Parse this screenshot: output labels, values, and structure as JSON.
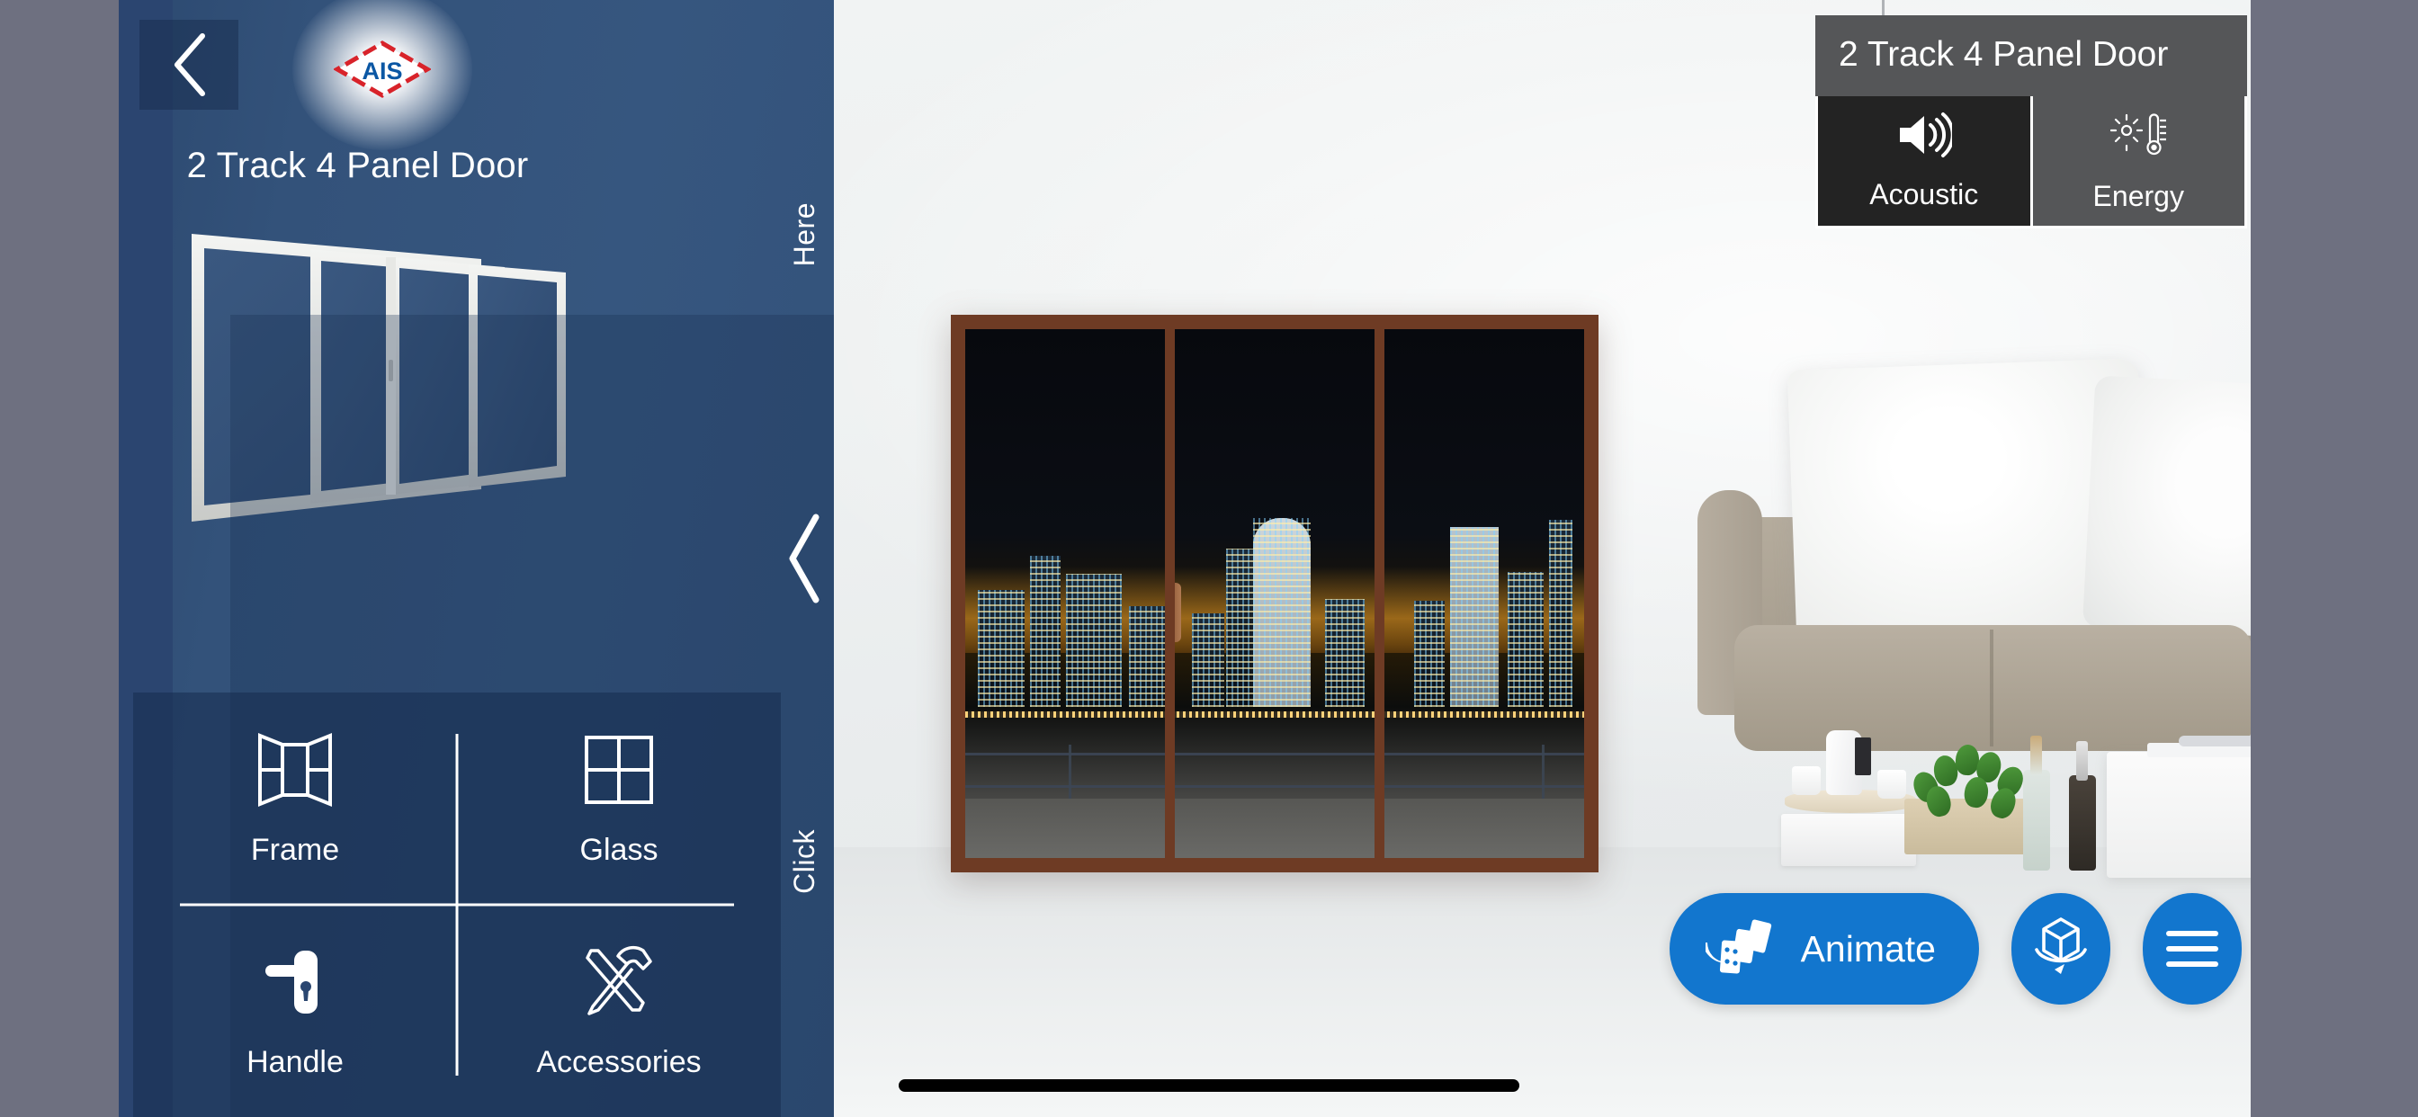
{
  "app": {
    "brand_logo": "ais-logo",
    "accent_blue": "#1276CE",
    "panel_blue": "#33527A",
    "panel_blue_dark": "#2B4570",
    "gutter_grey": "#6E7080",
    "overlay_grey": "#555658",
    "overlay_active": "#232323"
  },
  "panel": {
    "back_icon": "chevron-left-icon",
    "logo_text": "AIS",
    "title": "2 Track 4 Panel Door",
    "product_preview": "2-track-4-panel-door-3d-render",
    "options": [
      {
        "label": "Frame",
        "icon": "frame-window-icon"
      },
      {
        "label": "Glass",
        "icon": "glass-grid-icon"
      },
      {
        "label": "Handle",
        "icon": "door-handle-icon"
      },
      {
        "label": "Accessories",
        "icon": "tools-hammer-screwdriver-icon"
      }
    ]
  },
  "collapse_handle": {
    "top_label": "Here",
    "bottom_label": "Click",
    "icon": "chevron-left-icon"
  },
  "info_overlay": {
    "title": "2 Track 4 Panel Door",
    "tabs": [
      {
        "label": "Acoustic",
        "icon": "speaker-volume-icon",
        "state": "active"
      },
      {
        "label": "Energy",
        "icon": "thermometer-sun-icon",
        "state": "inactive"
      }
    ]
  },
  "actions": {
    "animate": {
      "label": "Animate",
      "icon": "dominoes-falling-icon"
    },
    "rotate": {
      "label": "",
      "icon": "cube-rotate-3d-icon"
    },
    "menu": {
      "label": "",
      "icon": "hamburger-menu-icon"
    }
  },
  "scene": {
    "product": "brown-sliding-door-4-panel",
    "backdrop": "night-city-skyline-view",
    "furniture": "beige-sofa-with-white-cushion"
  },
  "system": {
    "home_indicator": "home-indicator-bar"
  }
}
